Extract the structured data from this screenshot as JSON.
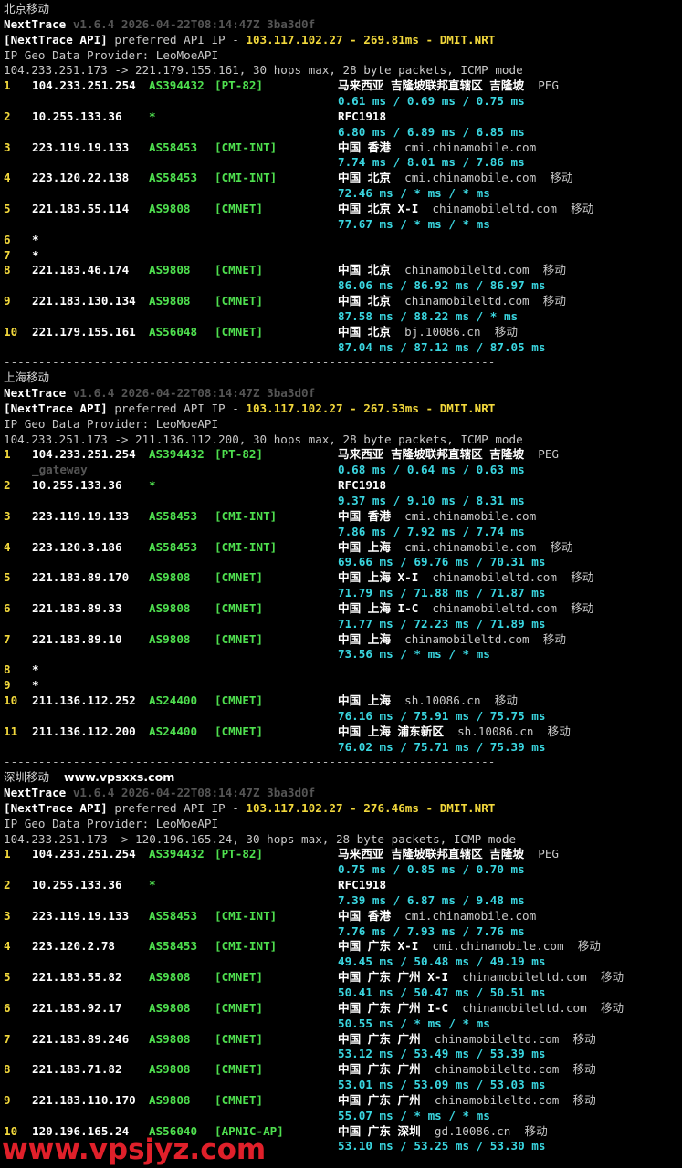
{
  "sections": [
    {
      "caption": "北京移动",
      "site": "",
      "nexttrace": {
        "name": "NextTrace",
        "meta": " v1.6.4 2026-04-22T08:14:47Z 3ba3d0f"
      },
      "api": {
        "tag": "[NextTrace API]",
        "text": " preferred API IP - ",
        "ip": "103.117.102.27",
        "dash": " - ",
        "latency": "269.81ms",
        "dash2": " - ",
        "node": "DMIT.NRT"
      },
      "provider": "IP Geo Data Provider: LeoMoeAPI",
      "route": "104.233.251.173 -> 221.179.155.161, 30 hops max, 28 byte packets, ICMP mode",
      "hops": [
        {
          "no": "1",
          "ip": "104.233.251.254",
          "as": "AS394432",
          "tag": "[PT-82]",
          "geo": "马来西亚 吉隆坡联邦直辖区 吉隆坡",
          "domain": "",
          "isp": "PEG",
          "rtt": "0.61 ms / 0.69 ms / 0.75 ms"
        },
        {
          "no": "2",
          "ip": "10.255.133.36",
          "as": "*",
          "tag": "",
          "geo": "RFC1918",
          "domain": "",
          "isp": "",
          "rtt": "6.80 ms / 6.89 ms / 6.85 ms"
        },
        {
          "no": "3",
          "ip": "223.119.19.133",
          "as": "AS58453",
          "tag": "[CMI-INT]",
          "geo": "中国 香港",
          "domain": "cmi.chinamobile.com",
          "isp": "",
          "rtt": "7.74 ms / 8.01 ms / 7.86 ms"
        },
        {
          "no": "4",
          "ip": "223.120.22.138",
          "as": "AS58453",
          "tag": "[CMI-INT]",
          "geo": "中国 北京",
          "domain": "cmi.chinamobile.com",
          "isp": "移动",
          "rtt": "72.46 ms / * ms / * ms"
        },
        {
          "no": "5",
          "ip": "221.183.55.114",
          "as": "AS9808",
          "tag": "[CMNET]",
          "geo": "中国 北京 X-I",
          "domain": "chinamobileltd.com",
          "isp": "移动",
          "rtt": "77.67 ms / * ms / * ms"
        },
        {
          "no": "6",
          "ip": "*",
          "as": "",
          "tag": "",
          "geo": "",
          "domain": "",
          "isp": "",
          "rtt": ""
        },
        {
          "no": "7",
          "ip": "*",
          "as": "",
          "tag": "",
          "geo": "",
          "domain": "",
          "isp": "",
          "rtt": ""
        },
        {
          "no": "8",
          "ip": "221.183.46.174",
          "as": "AS9808",
          "tag": "[CMNET]",
          "geo": "中国 北京",
          "domain": "chinamobileltd.com",
          "isp": "移动",
          "rtt": "86.06 ms / 86.92 ms / 86.97 ms"
        },
        {
          "no": "9",
          "ip": "221.183.130.134",
          "as": "AS9808",
          "tag": "[CMNET]",
          "geo": "中国 北京",
          "domain": "chinamobileltd.com",
          "isp": "移动",
          "rtt": "87.58 ms / 88.22 ms / * ms"
        },
        {
          "no": "10",
          "ip": "221.179.155.161",
          "as": "AS56048",
          "tag": "[CMNET]",
          "geo": "中国 北京",
          "domain": "bj.10086.cn",
          "isp": "移动",
          "rtt": "87.04 ms / 87.12 ms / 87.05 ms"
        }
      ],
      "separator": "-----------------------------------------------------------------------"
    },
    {
      "caption": "上海移动",
      "site": "",
      "nexttrace": {
        "name": "NextTrace",
        "meta": " v1.6.4 2026-04-22T08:14:47Z 3ba3d0f"
      },
      "api": {
        "tag": "[NextTrace API]",
        "text": " preferred API IP - ",
        "ip": "103.117.102.27",
        "dash": " - ",
        "latency": "267.53ms",
        "dash2": " - ",
        "node": "DMIT.NRT"
      },
      "provider": "IP Geo Data Provider: LeoMoeAPI",
      "route": "104.233.251.173 -> 211.136.112.200, 30 hops max, 28 byte packets, ICMP mode",
      "hops": [
        {
          "no": "1",
          "ip": "104.233.251.254",
          "as": "AS394432",
          "tag": "[PT-82]",
          "geo": "马来西亚 吉隆坡联邦直辖区 吉隆坡",
          "domain": "",
          "isp": "PEG",
          "sub": "_gateway",
          "rtt": "0.68 ms / 0.64 ms / 0.63 ms"
        },
        {
          "no": "2",
          "ip": "10.255.133.36",
          "as": "*",
          "tag": "",
          "geo": "RFC1918",
          "domain": "",
          "isp": "",
          "rtt": "9.37 ms / 9.10 ms / 8.31 ms"
        },
        {
          "no": "3",
          "ip": "223.119.19.133",
          "as": "AS58453",
          "tag": "[CMI-INT]",
          "geo": "中国 香港",
          "domain": "cmi.chinamobile.com",
          "isp": "",
          "rtt": "7.86 ms / 7.92 ms / 7.74 ms"
        },
        {
          "no": "4",
          "ip": "223.120.3.186",
          "as": "AS58453",
          "tag": "[CMI-INT]",
          "geo": "中国 上海",
          "domain": "cmi.chinamobile.com",
          "isp": "移动",
          "rtt": "69.66 ms / 69.76 ms / 70.31 ms"
        },
        {
          "no": "5",
          "ip": "221.183.89.170",
          "as": "AS9808",
          "tag": "[CMNET]",
          "geo": "中国 上海 X-I",
          "domain": "chinamobileltd.com",
          "isp": "移动",
          "rtt": "71.79 ms / 71.88 ms / 71.87 ms"
        },
        {
          "no": "6",
          "ip": "221.183.89.33",
          "as": "AS9808",
          "tag": "[CMNET]",
          "geo": "中国 上海 I-C",
          "domain": "chinamobileltd.com",
          "isp": "移动",
          "rtt": "71.77 ms / 72.23 ms / 71.89 ms"
        },
        {
          "no": "7",
          "ip": "221.183.89.10",
          "as": "AS9808",
          "tag": "[CMNET]",
          "geo": "中国 上海",
          "domain": "chinamobileltd.com",
          "isp": "移动",
          "rtt": "73.56 ms / * ms / * ms"
        },
        {
          "no": "8",
          "ip": "*",
          "as": "",
          "tag": "",
          "geo": "",
          "domain": "",
          "isp": "",
          "rtt": ""
        },
        {
          "no": "9",
          "ip": "*",
          "as": "",
          "tag": "",
          "geo": "",
          "domain": "",
          "isp": "",
          "rtt": ""
        },
        {
          "no": "10",
          "ip": "211.136.112.252",
          "as": "AS24400",
          "tag": "[CMNET]",
          "geo": "中国 上海",
          "domain": "sh.10086.cn",
          "isp": "移动",
          "rtt": "76.16 ms / 75.91 ms / 75.75 ms"
        },
        {
          "no": "11",
          "ip": "211.136.112.200",
          "as": "AS24400",
          "tag": "[CMNET]",
          "geo": "中国 上海 浦东新区",
          "domain": "sh.10086.cn",
          "isp": "移动",
          "rtt": "76.02 ms / 75.71 ms / 75.39 ms"
        }
      ],
      "separator": "-----------------------------------------------------------------------"
    },
    {
      "caption": "深圳移动",
      "site": "www.vpsxxs.com",
      "nexttrace": {
        "name": "NextTrace",
        "meta": " v1.6.4 2026-04-22T08:14:47Z 3ba3d0f"
      },
      "api": {
        "tag": "[NextTrace API]",
        "text": " preferred API IP - ",
        "ip": "103.117.102.27",
        "dash": " - ",
        "latency": "276.46ms",
        "dash2": " - ",
        "node": "DMIT.NRT"
      },
      "provider": "IP Geo Data Provider: LeoMoeAPI",
      "route": "104.233.251.173 -> 120.196.165.24, 30 hops max, 28 byte packets, ICMP mode",
      "hops": [
        {
          "no": "1",
          "ip": "104.233.251.254",
          "as": "AS394432",
          "tag": "[PT-82]",
          "geo": "马来西亚 吉隆坡联邦直辖区 吉隆坡",
          "domain": "",
          "isp": "PEG",
          "rtt": "0.75 ms / 0.85 ms / 0.70 ms"
        },
        {
          "no": "2",
          "ip": "10.255.133.36",
          "as": "*",
          "tag": "",
          "geo": "RFC1918",
          "domain": "",
          "isp": "",
          "rtt": "7.39 ms / 6.87 ms / 9.48 ms"
        },
        {
          "no": "3",
          "ip": "223.119.19.133",
          "as": "AS58453",
          "tag": "[CMI-INT]",
          "geo": "中国 香港",
          "domain": "cmi.chinamobile.com",
          "isp": "",
          "rtt": "7.76 ms / 7.93 ms / 7.76 ms"
        },
        {
          "no": "4",
          "ip": "223.120.2.78",
          "as": "AS58453",
          "tag": "[CMI-INT]",
          "geo": "中国 广东 X-I",
          "domain": "cmi.chinamobile.com",
          "isp": "移动",
          "rtt": "49.45 ms / 50.48 ms / 49.19 ms"
        },
        {
          "no": "5",
          "ip": "221.183.55.82",
          "as": "AS9808",
          "tag": "[CMNET]",
          "geo": "中国 广东 广州 X-I",
          "domain": "chinamobileltd.com",
          "isp": "移动",
          "rtt": "50.41 ms / 50.47 ms / 50.51 ms"
        },
        {
          "no": "6",
          "ip": "221.183.92.17",
          "as": "AS9808",
          "tag": "[CMNET]",
          "geo": "中国 广东 广州 I-C",
          "domain": "chinamobileltd.com",
          "isp": "移动",
          "rtt": "50.55 ms / * ms / * ms"
        },
        {
          "no": "7",
          "ip": "221.183.89.246",
          "as": "AS9808",
          "tag": "[CMNET]",
          "geo": "中国 广东 广州",
          "domain": "chinamobileltd.com",
          "isp": "移动",
          "rtt": "53.12 ms / 53.49 ms / 53.39 ms"
        },
        {
          "no": "8",
          "ip": "221.183.71.82",
          "as": "AS9808",
          "tag": "[CMNET]",
          "geo": "中国 广东 广州",
          "domain": "chinamobileltd.com",
          "isp": "移动",
          "rtt": "53.01 ms / 53.09 ms / 53.03 ms"
        },
        {
          "no": "9",
          "ip": "221.183.110.170",
          "as": "AS9808",
          "tag": "[CMNET]",
          "geo": "中国 广东 广州",
          "domain": "chinamobileltd.com",
          "isp": "移动",
          "rtt": "55.07 ms / * ms / * ms"
        },
        {
          "no": "10",
          "ip": "120.196.165.24",
          "as": "AS56040",
          "tag": "[APNIC-AP]",
          "geo": "中国 广东 深圳",
          "domain": "gd.10086.cn",
          "isp": "移动",
          "rtt": "53.10 ms / 53.25 ms / 53.30 ms"
        }
      ],
      "separator": ""
    }
  ],
  "watermark": "www.vpsjyz.com",
  "colors": {
    "background": "#000000",
    "hop_number": "#f2d83c",
    "ip": "#ffffff",
    "asn": "#4fe04f",
    "rtt": "#3ad6e0",
    "watermark": "#e0202a"
  }
}
